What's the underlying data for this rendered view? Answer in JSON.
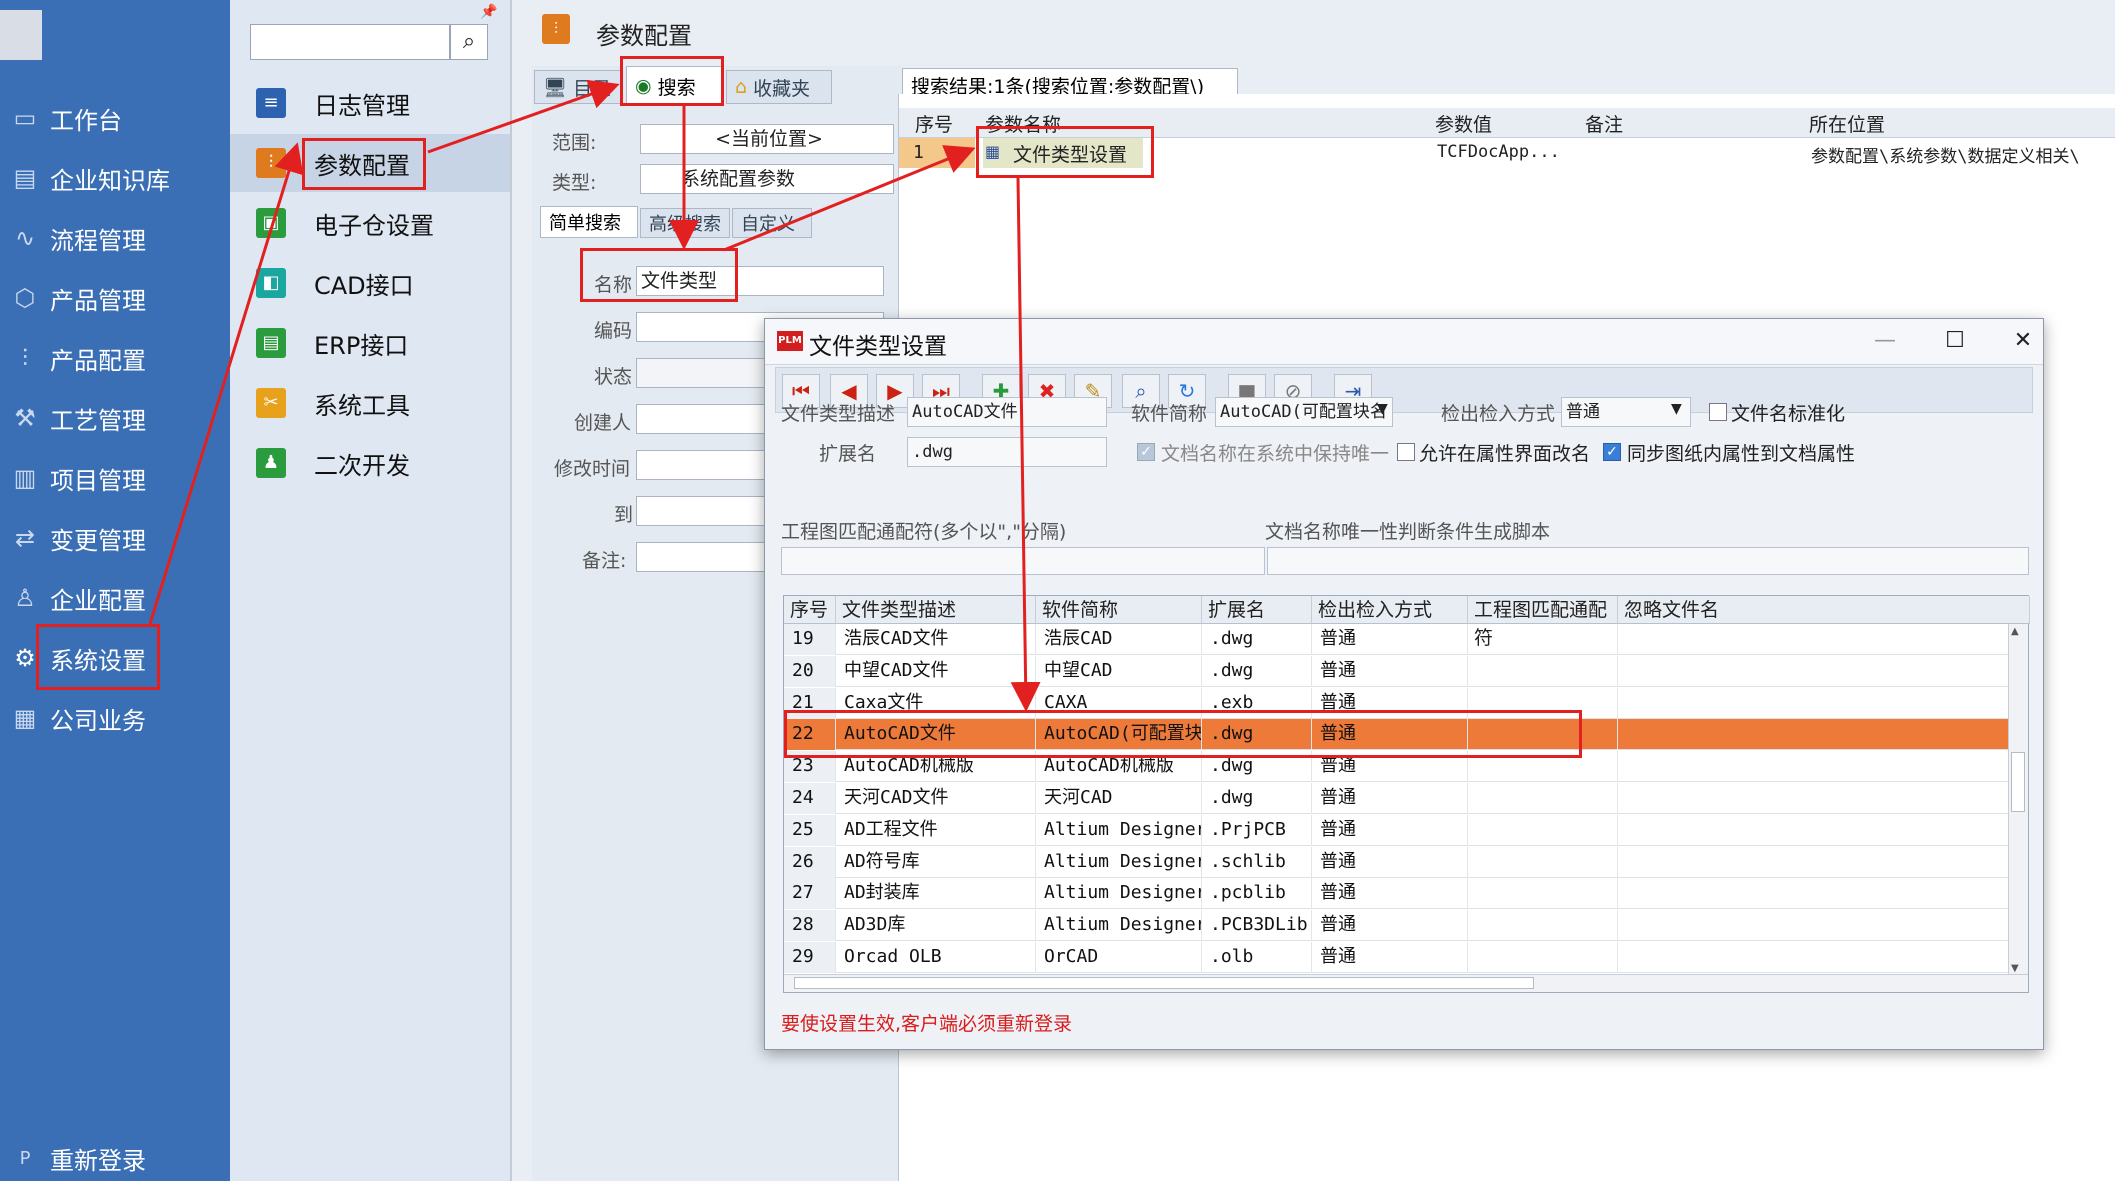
{
  "nav": {
    "items": [
      {
        "label": "工作台",
        "icon": "desktop-icon"
      },
      {
        "label": "企业知识库",
        "icon": "book-icon"
      },
      {
        "label": "流程管理",
        "icon": "flow-icon"
      },
      {
        "label": "产品管理",
        "icon": "cube-icon"
      },
      {
        "label": "产品配置",
        "icon": "sliders-icon"
      },
      {
        "label": "工艺管理",
        "icon": "wrench-icon"
      },
      {
        "label": "项目管理",
        "icon": "chart-icon"
      },
      {
        "label": "变更管理",
        "icon": "swap-icon"
      },
      {
        "label": "企业配置",
        "icon": "users-icon"
      },
      {
        "label": "系统设置",
        "icon": "gear-icon"
      },
      {
        "label": "公司业务",
        "icon": "grid-icon"
      }
    ],
    "relogin": "重新登录",
    "relogin_icon": "P"
  },
  "sub": {
    "items": [
      {
        "label": "日志管理",
        "color": "#2d62b0",
        "glyph": "≡"
      },
      {
        "label": "参数配置",
        "color": "#e07a1e",
        "glyph": "⫶"
      },
      {
        "label": "电子仓设置",
        "color": "#2b9c3e",
        "glyph": "▣"
      },
      {
        "label": "CAD接口",
        "color": "#1aa7a0",
        "glyph": "◧"
      },
      {
        "label": "ERP接口",
        "color": "#2b9c3e",
        "glyph": "▤"
      },
      {
        "label": "系统工具",
        "color": "#e8a11a",
        "glyph": "✂"
      },
      {
        "label": "二次开发",
        "color": "#2b9c3e",
        "glyph": "♟"
      }
    ]
  },
  "page": {
    "title": "参数配置"
  },
  "tabs": {
    "catalog": "目录",
    "search": "搜索",
    "favorites": "收藏夹"
  },
  "search_form": {
    "scope_label": "范围:",
    "scope_value": "<当前位置>",
    "type_label": "类型:",
    "type_value": "系统配置参数",
    "subtabs": {
      "simple": "简单搜索",
      "advanced": "高级搜索",
      "custom": "自定义"
    },
    "name_label": "名称",
    "name_value": "文件类型",
    "code_label": "编码",
    "status_label": "状态",
    "creator_label": "创建人",
    "modified_label": "修改时间",
    "to_label": "到",
    "remark_label": "备注:"
  },
  "results": {
    "header": "搜索结果:1条(搜索位置:参数配置\\)",
    "columns": [
      "序号",
      "参数名称",
      "参数值",
      "备注",
      "所在位置"
    ],
    "row": {
      "no": "1",
      "name": "文件类型设置",
      "value": "TCFDocApp...",
      "remark": "",
      "location": "参数配置\\系统参数\\数据定义相关\\"
    }
  },
  "dialog": {
    "title": "文件类型设置",
    "logo": "PLM",
    "fields": {
      "desc_label": "文件类型描述",
      "desc_value": "AutoCAD文件",
      "soft_label": "软件简称",
      "soft_value": "AutoCAD(可配置块名",
      "checkin_label": "检出检入方式",
      "checkin_value": "普通",
      "normalize_label": "文件名标准化",
      "ext_label": "扩展名",
      "ext_value": ".dwg",
      "unique_label": "文档名称在系统中保持唯一",
      "rename_label": "允许在属性界面改名",
      "sync_label": "同步图纸内属性到文档属性",
      "pattern_label": "工程图匹配通配符(多个以\",\"分隔)",
      "script_label": "文档名称唯一性判断条件生成脚本"
    },
    "grid": {
      "columns": [
        "序号",
        "文件类型描述",
        "软件简称",
        "扩展名",
        "检出检入方式",
        "工程图匹配通配符",
        "忽略文件名"
      ],
      "rows": [
        [
          "19",
          "浩辰CAD文件",
          "浩辰CAD",
          ".dwg",
          "普通"
        ],
        [
          "20",
          "中望CAD文件",
          "中望CAD",
          ".dwg",
          "普通"
        ],
        [
          "21",
          "Caxa文件",
          "CAXA",
          ".exb",
          "普通"
        ],
        [
          "22",
          "AutoCAD文件",
          "AutoCAD(可配置块名)",
          ".dwg",
          "普通"
        ],
        [
          "23",
          "AutoCAD机械版",
          "AutoCAD机械版",
          ".dwg",
          "普通"
        ],
        [
          "24",
          "天河CAD文件",
          "天河CAD",
          ".dwg",
          "普通"
        ],
        [
          "25",
          "AD工程文件",
          "Altium Designer",
          ".PrjPCB",
          "普通"
        ],
        [
          "26",
          "AD符号库",
          "Altium Designer",
          ".schlib",
          "普通"
        ],
        [
          "27",
          "AD封装库",
          "Altium Designer",
          ".pcblib",
          "普通"
        ],
        [
          "28",
          "AD3D库",
          "Altium Designer",
          ".PCB3DLib",
          "普通"
        ],
        [
          "29",
          "Orcad OLB",
          "OrCAD",
          ".olb",
          "普通"
        ]
      ]
    },
    "note": "要使设置生效,客户端必须重新登录"
  },
  "colors": {
    "nav_bg": "#3a6fb5",
    "highlight": "#ee7a3a",
    "annotation": "#e32020"
  }
}
